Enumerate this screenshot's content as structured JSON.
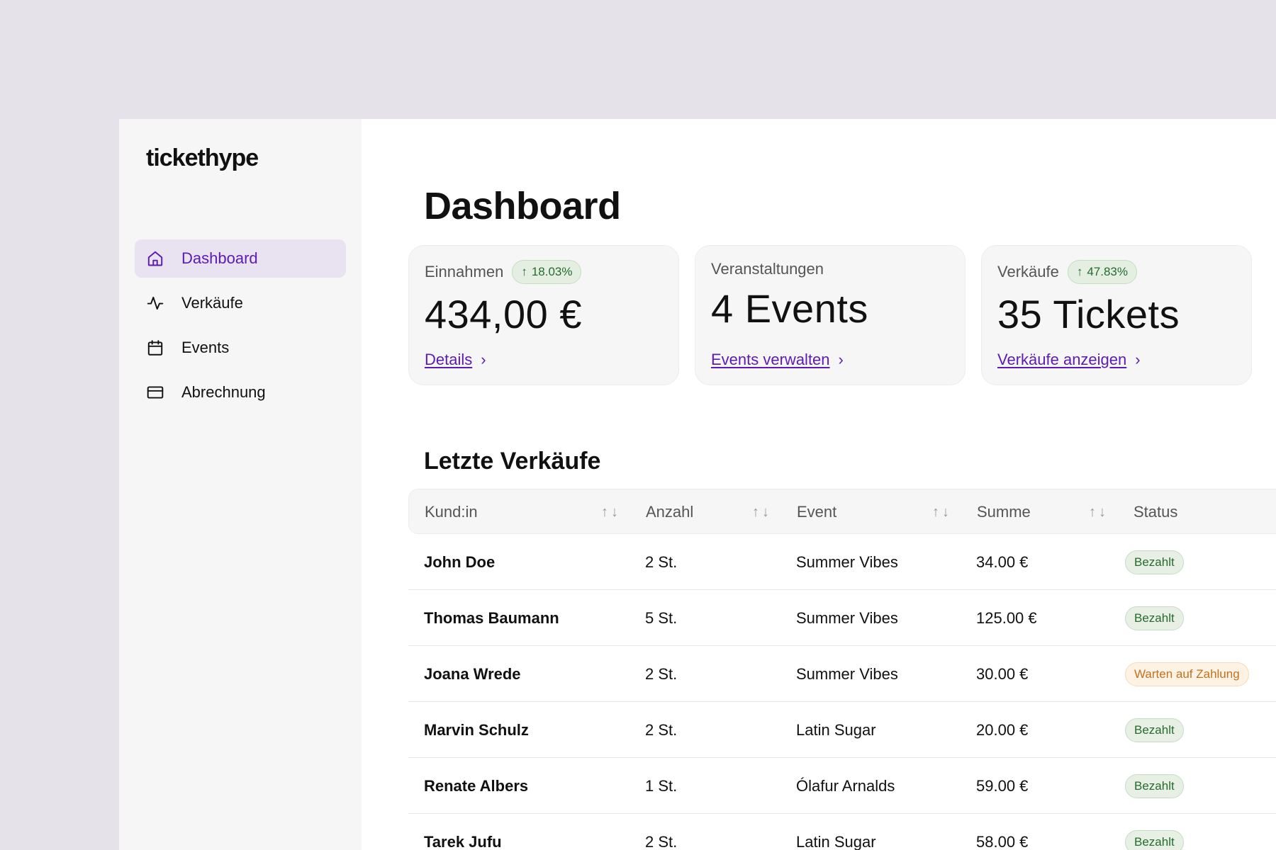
{
  "app": {
    "logo": "tickethype"
  },
  "sidebar": {
    "items": [
      {
        "label": "Dashboard",
        "icon": "home-icon",
        "active": true
      },
      {
        "label": "Verkäufe",
        "icon": "activity-icon",
        "active": false
      },
      {
        "label": "Events",
        "icon": "calendar-icon",
        "active": false
      },
      {
        "label": "Abrechnung",
        "icon": "credit-card-icon",
        "active": false
      }
    ]
  },
  "main": {
    "title": "Dashboard",
    "cards": [
      {
        "label": "Einnahmen",
        "trend": "18.03%",
        "value": "434,00 €",
        "link": "Details"
      },
      {
        "label": "Veranstaltungen",
        "trend": "",
        "value": "4 Events",
        "link": "Events verwalten"
      },
      {
        "label": "Verkäufe",
        "trend": "47.83%",
        "value": "35 Tickets",
        "link": "Verkäufe anzeigen"
      }
    ],
    "recent_sales": {
      "title": "Letzte Verkäufe",
      "columns": [
        "Kund:in",
        "Anzahl",
        "Event",
        "Summe",
        "Status"
      ],
      "rows": [
        {
          "customer": "John Doe",
          "qty": "2 St.",
          "event": "Summer Vibes",
          "sum": "34.00 €",
          "status": "Bezahlt"
        },
        {
          "customer": "Thomas Baumann",
          "qty": "5 St.",
          "event": "Summer Vibes",
          "sum": "125.00 €",
          "status": "Bezahlt"
        },
        {
          "customer": "Joana Wrede",
          "qty": "2 St.",
          "event": "Summer Vibes",
          "sum": "30.00 €",
          "status": "Warten auf Zahlung"
        },
        {
          "customer": "Marvin Schulz",
          "qty": "2 St.",
          "event": "Latin Sugar",
          "sum": "20.00 €",
          "status": "Bezahlt"
        },
        {
          "customer": "Renate Albers",
          "qty": "1 St.",
          "event": "Ólafur Arnalds",
          "sum": "59.00 €",
          "status": "Bezahlt"
        },
        {
          "customer": "Tarek Jufu",
          "qty": "2 St.",
          "event": "Latin Sugar",
          "sum": "58.00 €",
          "status": "Bezahlt"
        }
      ]
    }
  },
  "colors": {
    "accent": "#5b1bb5",
    "active_nav_bg": "#e8e2f1",
    "status_paid": "#256b2c",
    "status_pending": "#c4701c",
    "backdrop": "#e5e2ea"
  }
}
